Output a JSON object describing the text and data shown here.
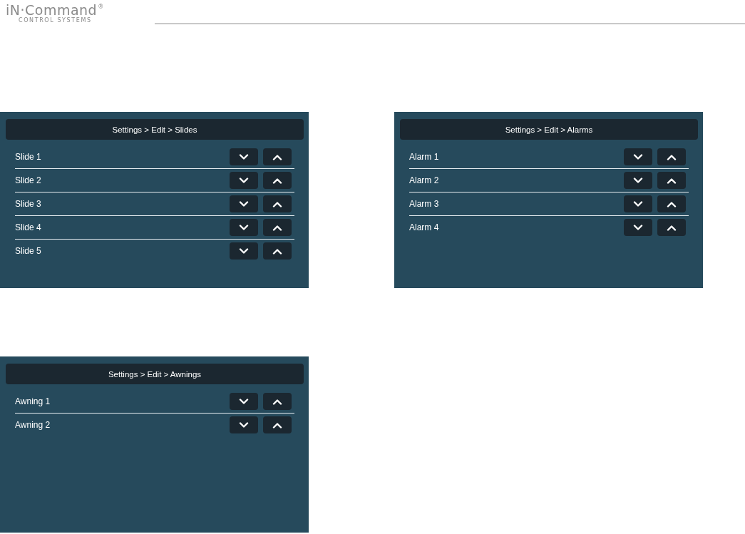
{
  "logo": {
    "name": "iN·Command",
    "mark": "®",
    "tagline": "CONTROL SYSTEMS"
  },
  "panels": [
    {
      "title": "Settings > Edit > Slides",
      "rows": [
        {
          "label": "Slide 1"
        },
        {
          "label": "Slide 2"
        },
        {
          "label": "Slide 3"
        },
        {
          "label": "Slide 4"
        },
        {
          "label": "Slide 5"
        }
      ]
    },
    {
      "title": "Settings > Edit > Alarms",
      "rows": [
        {
          "label": "Alarm 1"
        },
        {
          "label": "Alarm 2"
        },
        {
          "label": "Alarm 3"
        },
        {
          "label": "Alarm 4"
        }
      ]
    },
    {
      "title": "Settings > Edit > Awnings",
      "rows": [
        {
          "label": "Awning 1"
        },
        {
          "label": "Awning 2"
        }
      ]
    }
  ]
}
